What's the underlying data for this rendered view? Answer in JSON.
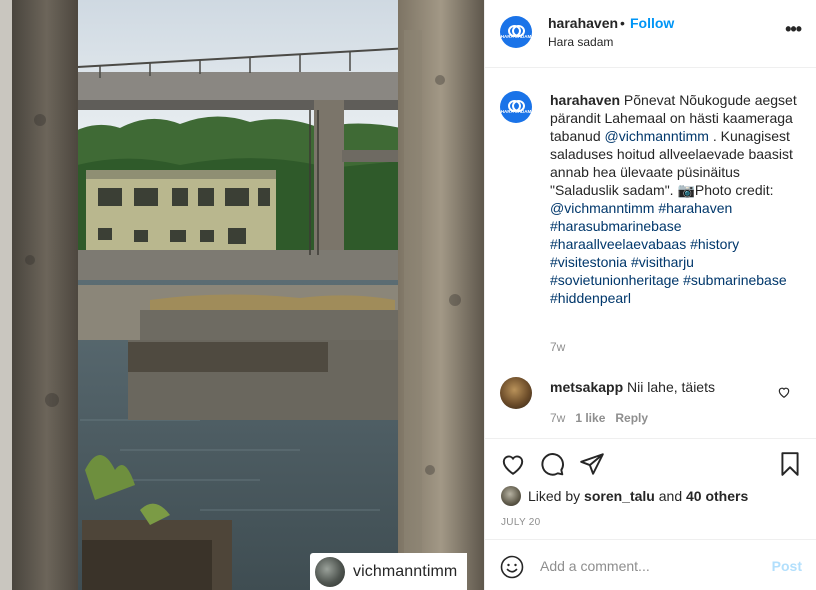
{
  "post": {
    "username": "harahaven",
    "follow_dot": "•",
    "follow_label": "Follow",
    "location": "Hara sadam",
    "more_label": "•••",
    "logo_text": "HARA SADAM"
  },
  "photo": {
    "tag_username": "vichmanntimm"
  },
  "caption": {
    "username": "harahaven",
    "text_1": " Põnevat Nõukogude aegset pärandit Lahemaal on hästi kaameraga tabanud ",
    "mention": "@vichmanntimm",
    "text_2": " . Kunagisest saladuses hoitud allveelaevade baasist annab hea ülevaate püsinäitus \"Saladuslik sadam\". ",
    "camera_glyph": "📷",
    "text_3": "Photo credit: ",
    "mention_2": "@vichmanntimm",
    "hashtags": [
      "#harahaven",
      "#harasubmarinebase",
      "#haraallveelaevabaas",
      "#history",
      "#visitestonia",
      "#visitharju",
      "#sovietunionheritage",
      "#submarinebase",
      "#hiddenpearl"
    ],
    "time": "7w"
  },
  "comment": {
    "username": "metsakapp",
    "text": "Nii lahe, täiets",
    "time": "7w",
    "likes": "1 like",
    "reply_label": "Reply"
  },
  "likes": {
    "prefix": "Liked by ",
    "user": "soren_talu",
    "middle": " and ",
    "others": "40 others"
  },
  "date": "JULY 20",
  "add_comment": {
    "placeholder": "Add a comment...",
    "post_label": "Post"
  },
  "colors": {
    "link": "#0095f6",
    "hashtag": "#00376b",
    "brand": "#1a73e8",
    "muted": "#8e8e8e"
  }
}
